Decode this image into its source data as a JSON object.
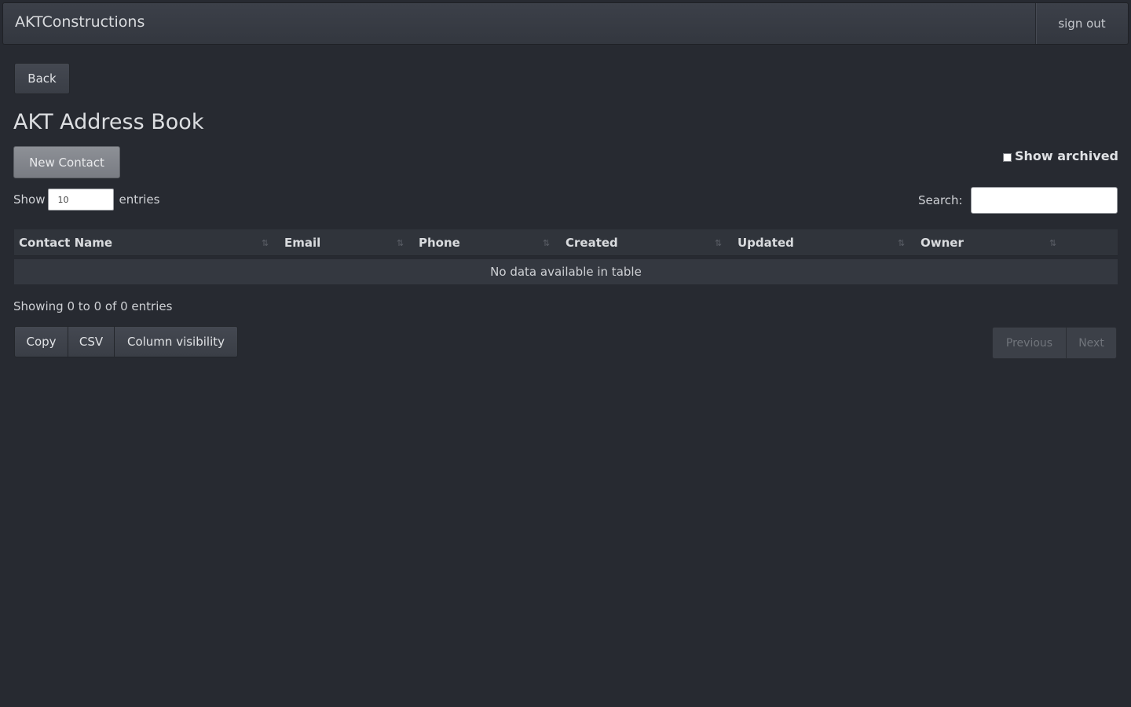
{
  "navbar": {
    "brand": "AKTConstructions",
    "sign_out": "sign out"
  },
  "toolbar": {
    "back_label": "Back"
  },
  "page": {
    "title": "AKT Address Book",
    "new_contact_label": "New Contact",
    "show_archived_label": "Show archived"
  },
  "length": {
    "show_label": "Show",
    "value": "10",
    "entries_label": "entries"
  },
  "search": {
    "label": "Search:",
    "value": ""
  },
  "table": {
    "columns": [
      "Contact Name",
      "Email",
      "Phone",
      "Created",
      "Updated",
      "Owner"
    ],
    "sort_icon": "⇅",
    "empty_message": "No data available in table"
  },
  "info": {
    "text": "Showing 0 to 0 of 0 entries"
  },
  "export": {
    "copy_label": "Copy",
    "csv_label": "CSV",
    "colvis_label": "Column visibility"
  },
  "pagination": {
    "previous_label": "Previous",
    "next_label": "Next"
  }
}
